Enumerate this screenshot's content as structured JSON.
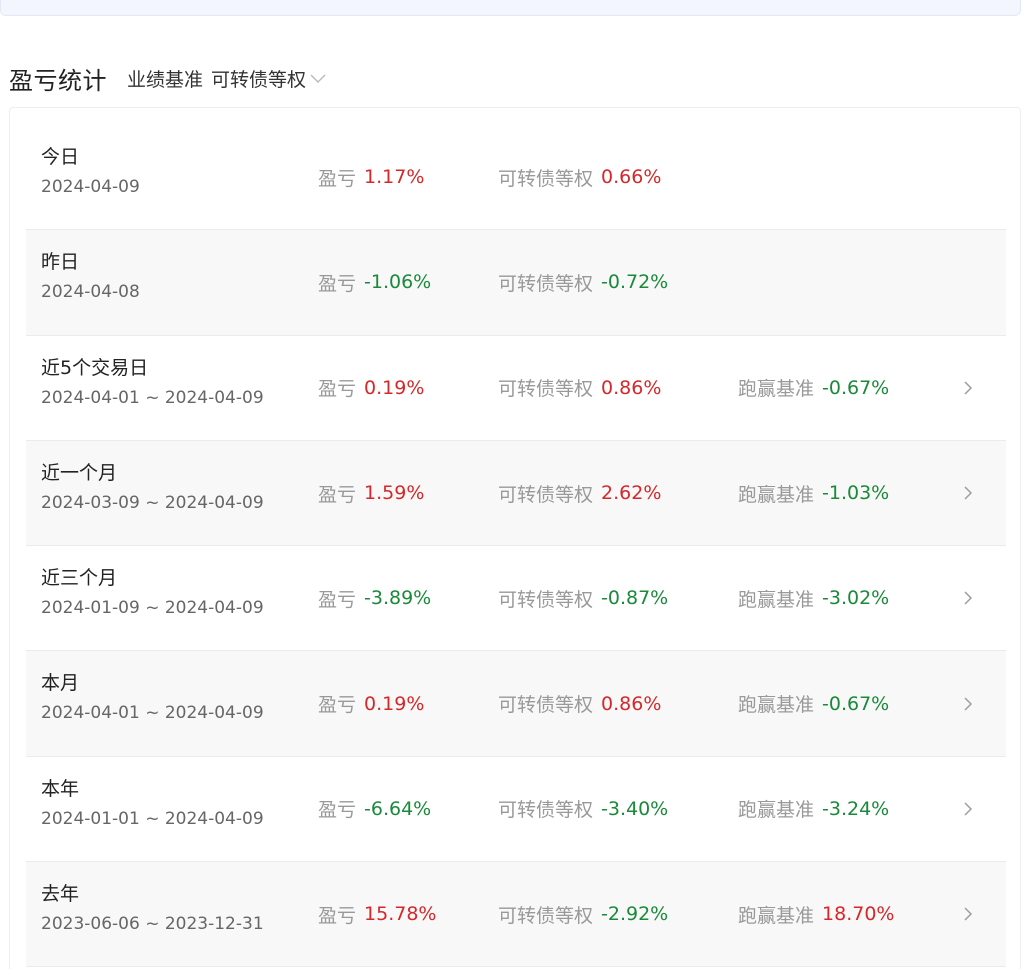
{
  "header": {
    "title": "盈亏统计",
    "benchmark_label": "业绩基准",
    "benchmark_value": "可转债等权"
  },
  "colors": {
    "positive": "#d4282a",
    "negative": "#1a8a3a",
    "muted": "#999999"
  },
  "rows": [
    {
      "name": "今日",
      "date": "2024-04-09",
      "pnl_label": "盈亏",
      "pnl": "1.17%",
      "bench_label": "可转债等权",
      "bench": "0.66%",
      "beat_label": "",
      "beat": "",
      "has_arrow": false
    },
    {
      "name": "昨日",
      "date": "2024-04-08",
      "pnl_label": "盈亏",
      "pnl": "-1.06%",
      "bench_label": "可转债等权",
      "bench": "-0.72%",
      "beat_label": "",
      "beat": "",
      "has_arrow": false
    },
    {
      "name": "近5个交易日",
      "date": "2024-04-01 ~ 2024-04-09",
      "pnl_label": "盈亏",
      "pnl": "0.19%",
      "bench_label": "可转债等权",
      "bench": "0.86%",
      "beat_label": "跑赢基准",
      "beat": "-0.67%",
      "has_arrow": true
    },
    {
      "name": "近一个月",
      "date": "2024-03-09 ~ 2024-04-09",
      "pnl_label": "盈亏",
      "pnl": "1.59%",
      "bench_label": "可转债等权",
      "bench": "2.62%",
      "beat_label": "跑赢基准",
      "beat": "-1.03%",
      "has_arrow": true
    },
    {
      "name": "近三个月",
      "date": "2024-01-09 ~ 2024-04-09",
      "pnl_label": "盈亏",
      "pnl": "-3.89%",
      "bench_label": "可转债等权",
      "bench": "-0.87%",
      "beat_label": "跑赢基准",
      "beat": "-3.02%",
      "has_arrow": true
    },
    {
      "name": "本月",
      "date": "2024-04-01 ~ 2024-04-09",
      "pnl_label": "盈亏",
      "pnl": "0.19%",
      "bench_label": "可转债等权",
      "bench": "0.86%",
      "beat_label": "跑赢基准",
      "beat": "-0.67%",
      "has_arrow": true
    },
    {
      "name": "本年",
      "date": "2024-01-01 ~ 2024-04-09",
      "pnl_label": "盈亏",
      "pnl": "-6.64%",
      "bench_label": "可转债等权",
      "bench": "-3.40%",
      "beat_label": "跑赢基准",
      "beat": "-3.24%",
      "has_arrow": true
    },
    {
      "name": "去年",
      "date": "2023-06-06 ~ 2023-12-31",
      "pnl_label": "盈亏",
      "pnl": "15.78%",
      "bench_label": "可转债等权",
      "bench": "-2.92%",
      "beat_label": "跑赢基准",
      "beat": "18.70%",
      "has_arrow": true
    }
  ],
  "icons": {
    "dropdown": "chevron-down-icon",
    "row_arrow": "chevron-right-icon"
  }
}
